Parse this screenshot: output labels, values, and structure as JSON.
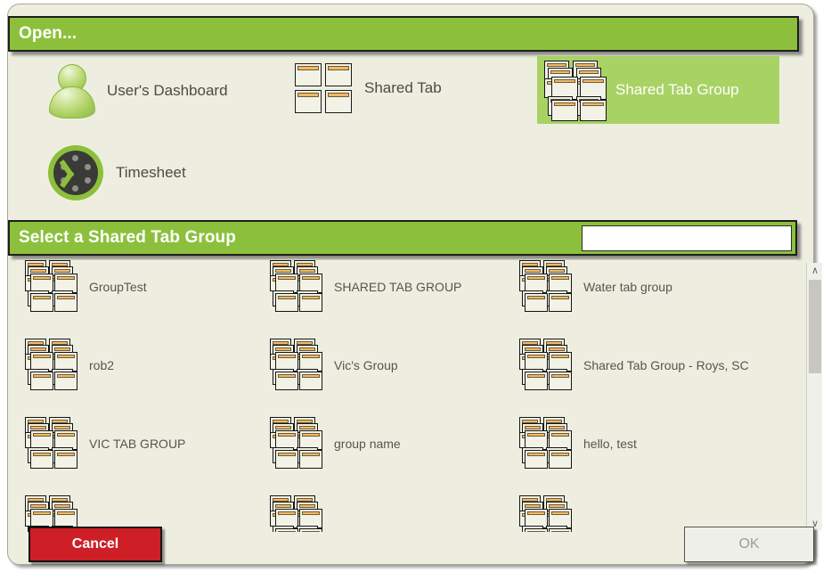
{
  "dialog": {
    "open_header": "Open...",
    "select_header": "Select a Shared Tab Group"
  },
  "search": {
    "value": "",
    "placeholder": ""
  },
  "type_chooser": {
    "items": [
      {
        "label": "User's Dashboard",
        "icon": "user-avatar-icon",
        "selected": false
      },
      {
        "label": "Shared Tab",
        "icon": "tab-panels-icon",
        "selected": false
      },
      {
        "label": "Shared Tab Group",
        "icon": "tab-group-icon",
        "selected": true
      },
      {
        "label": "Timesheet",
        "icon": "clock-icon",
        "selected": false
      }
    ]
  },
  "group_list": {
    "items": [
      {
        "label": "GroupTest"
      },
      {
        "label": "SHARED TAB GROUP"
      },
      {
        "label": "Water tab group"
      },
      {
        "label": "rob2"
      },
      {
        "label": "Vic's Group"
      },
      {
        "label": "Shared Tab Group - Roys, SC"
      },
      {
        "label": "VIC TAB GROUP"
      },
      {
        "label": "group name"
      },
      {
        "label": "hello, test"
      },
      {
        "label": ""
      },
      {
        "label": ""
      },
      {
        "label": ""
      }
    ]
  },
  "scrollbar": {
    "up_arrow": "∧",
    "down_arrow": "∨"
  },
  "footer": {
    "cancel_label": "Cancel",
    "ok_label": "OK"
  },
  "colors": {
    "header_green": "#8cc03c",
    "selection_green": "#a8d264",
    "cancel_red": "#ce1f26",
    "panel_bg": "#eeeee0",
    "tab_accent_orange": "#f4b963"
  }
}
